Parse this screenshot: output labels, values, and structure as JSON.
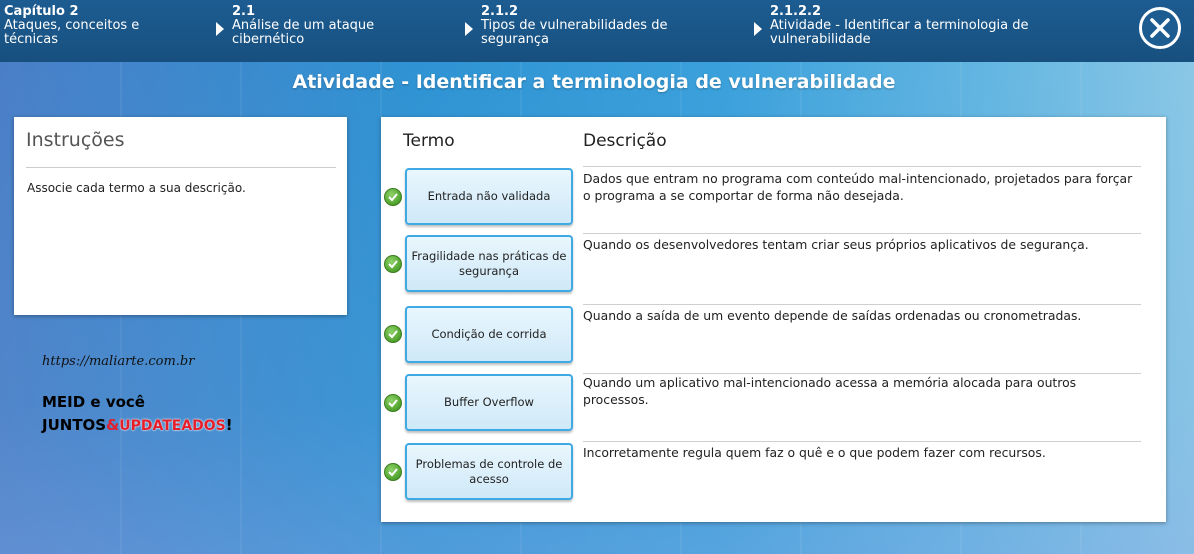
{
  "breadcrumbs": [
    {
      "number": "Capítulo 2",
      "text": "Ataques, conceitos e técnicas"
    },
    {
      "number": "2.1",
      "text": "Análise de um ataque cibernético"
    },
    {
      "number": "2.1.2",
      "text": "Tipos de vulnerabilidades de segurança"
    },
    {
      "number": "2.1.2.2",
      "text": "Atividade - Identificar a terminologia de vulnerabilidade"
    }
  ],
  "activity_title": "Atividade - Identificar a terminologia de vulnerabilidade",
  "instructions": {
    "heading": "Instruções",
    "body": "Associe cada termo a sua descrição."
  },
  "watermark": {
    "url": "https://maliarte.com.br",
    "line1": "MEID e você",
    "line2_part1": "JUNTOS",
    "line2_amp": "&",
    "line2_part2": "UPDATEADOS",
    "line2_end": "!"
  },
  "columns": {
    "term": "Termo",
    "description": "Descrição"
  },
  "rows": [
    {
      "term": "Entrada não validada",
      "description": "Dados que entram no programa com conteúdo mal-intencionado, projetados para forçar o programa a se comportar de forma não desejada.",
      "status": "correct"
    },
    {
      "term": "Fragilidade nas práticas de segurança",
      "description": "Quando os desenvolvedores tentam criar seus próprios aplicativos de segurança.",
      "status": "correct"
    },
    {
      "term": "Condição de corrida",
      "description": "Quando a saída de um evento depende de saídas ordenadas ou cronometradas.",
      "status": "correct"
    },
    {
      "term": "Buffer Overflow",
      "description": "Quando um aplicativo mal-intencionado acessa a memória alocada para outros processos.",
      "status": "correct"
    },
    {
      "term": "Problemas de controle de acesso",
      "description": "Incorretamente regula quem faz o quê e o que podem fazer com recursos.",
      "status": "correct"
    }
  ],
  "icons": {
    "close": "close-icon",
    "check": "check-icon",
    "breadcrumb_separator": "triangle-right-icon"
  },
  "colors": {
    "header": "#1d5c91",
    "term_border": "#3fa9e4",
    "check_green": "#4fa12c",
    "accent_red": "#e51e2a"
  }
}
